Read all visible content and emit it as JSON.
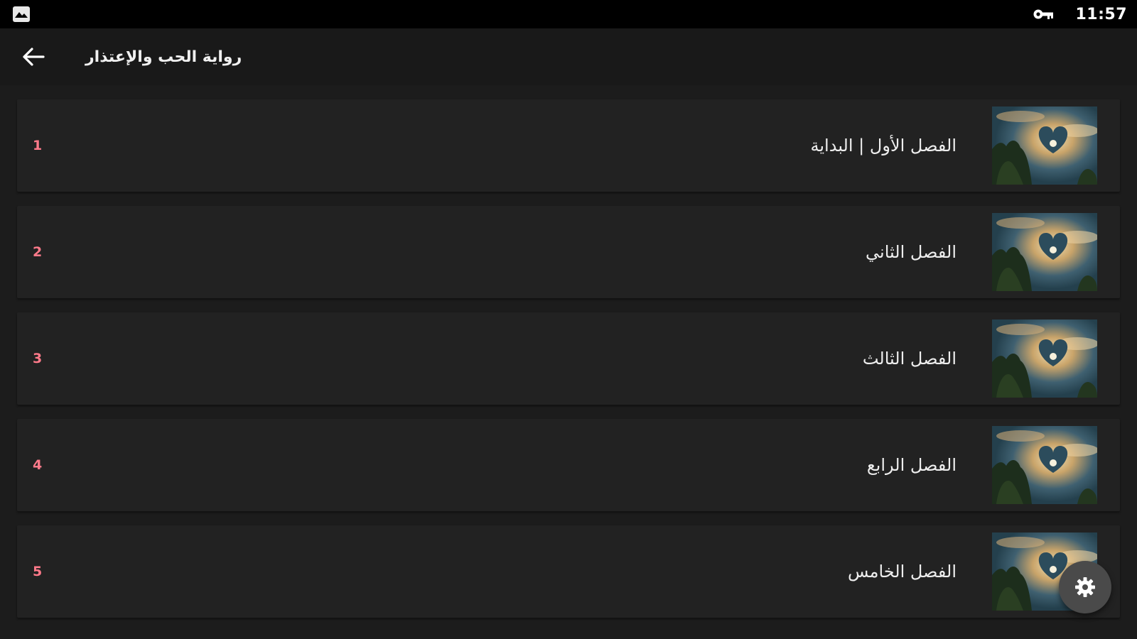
{
  "status_bar": {
    "left_icon": "image-icon",
    "key_icon": "vpn-key-icon",
    "time": "11:57"
  },
  "app_bar": {
    "back_icon": "arrow-back-icon",
    "title": "رواية الحب والإعتذار"
  },
  "chapters": [
    {
      "number": "1",
      "title": "الفصل الأول | البداية",
      "thumbnail": "heart-cloud-image"
    },
    {
      "number": "2",
      "title": "الفصل الثاني",
      "thumbnail": "heart-cloud-image"
    },
    {
      "number": "3",
      "title": "الفصل الثالث",
      "thumbnail": "heart-cloud-image"
    },
    {
      "number": "4",
      "title": "الفصل الرابع",
      "thumbnail": "heart-cloud-image"
    },
    {
      "number": "5",
      "title": "الفصل الخامس",
      "thumbnail": "heart-cloud-image"
    }
  ],
  "fab": {
    "icon": "gear-icon"
  },
  "colors": {
    "number_accent": "#ff7a8a",
    "row_background": "#222222",
    "status_bar": "#000000"
  }
}
